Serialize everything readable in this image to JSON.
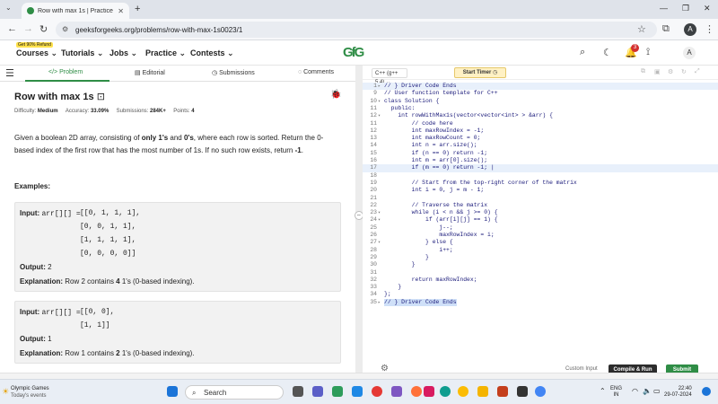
{
  "browser": {
    "tab_title": "Row with max 1s | Practice | Ge",
    "url": "geeksforgeeks.org/problems/row-with-max-1s0023/1",
    "profile_initial": "A"
  },
  "site_header": {
    "refund_badge": "Get 90% Refund",
    "nav": [
      "Courses",
      "Tutorials",
      "Jobs",
      "Practice",
      "Contests"
    ],
    "logo_text": "GfG",
    "notification_count": "3",
    "user_initial": "A"
  },
  "left_tabs": [
    "Problem",
    "Editorial",
    "Submissions",
    "Comments"
  ],
  "problem": {
    "title": "Row with max 1s",
    "difficulty_label": "Difficulty:",
    "difficulty": "Medium",
    "accuracy_label": "Accuracy:",
    "accuracy": "33.09%",
    "submissions_label": "Submissions:",
    "submissions": "284K+",
    "points_label": "Points:",
    "points": "4",
    "desc_1": "Given a boolean 2D array, consisting of ",
    "desc_b1": "only 1's",
    "desc_2": " and ",
    "desc_b2": "0's",
    "desc_3": ", where each row is sorted. Return the 0-based index of the first row that has the most number of 1s. If no such row exists, return ",
    "desc_b3": "-1",
    "desc_4": ".",
    "examples_heading": "Examples:"
  },
  "example1": {
    "input_label": "Input:",
    "input_var": "arr[][] =",
    "rows": [
      "[[0, 1, 1, 1],",
      "[0, 0, 1, 1],",
      "[1, 1, 1, 1],",
      "[0, 0, 0, 0]]"
    ],
    "output_label": "Output:",
    "output": "2",
    "expl_label": "Explanation:",
    "expl_1": "Row 2 contains ",
    "expl_b": "4",
    "expl_2": " 1's (0-based indexing)."
  },
  "example2": {
    "input_label": "Input:",
    "input_var": "arr[][] =",
    "rows": [
      "[[0, 0],",
      "[1, 1]]"
    ],
    "output_label": "Output:",
    "output": "1",
    "expl_label": "Explanation:",
    "expl_1": "Row 1 contains ",
    "expl_b": "2",
    "expl_2": " 1's (0-based indexing)."
  },
  "editor": {
    "language": "C++ (g++ 5.4)",
    "start_timer": "Start Timer",
    "custom_input": "Custom Input",
    "compile_run": "Compile & Run",
    "submit": "Submit",
    "lines": [
      {
        "n": "1",
        "fold": "▸",
        "text": "// } Driver Code Ends",
        "cls": "cmt",
        "hl": true
      },
      {
        "n": "9",
        "fold": "",
        "text": "// User function template for C++",
        "cls": "cmt"
      },
      {
        "n": "10",
        "fold": "▾",
        "text": "class Solution {",
        "cls": ""
      },
      {
        "n": "11",
        "fold": "",
        "text": "  public:",
        "cls": ""
      },
      {
        "n": "12",
        "fold": "▾",
        "text": "    int rowWithMax1s(vector<vector<int> > &arr) {",
        "cls": ""
      },
      {
        "n": "11",
        "fold": "",
        "text": "        // code here",
        "cls": "cmt"
      },
      {
        "n": "12",
        "fold": "",
        "text": "        int maxRowIndex = -1;",
        "cls": ""
      },
      {
        "n": "13",
        "fold": "",
        "text": "        int maxRowCount = 0;",
        "cls": ""
      },
      {
        "n": "14",
        "fold": "",
        "text": "        int n = arr.size();",
        "cls": ""
      },
      {
        "n": "15",
        "fold": "",
        "text": "        if (n == 0) return -1;",
        "cls": ""
      },
      {
        "n": "16",
        "fold": "",
        "text": "        int m = arr[0].size();",
        "cls": ""
      },
      {
        "n": "17",
        "fold": "",
        "text": "        if (m == 0) return -1; |",
        "cls": "",
        "hl": true
      },
      {
        "n": "18",
        "fold": "",
        "text": "",
        "cls": ""
      },
      {
        "n": "19",
        "fold": "",
        "text": "        // Start from the top-right corner of the matrix",
        "cls": "cmt"
      },
      {
        "n": "20",
        "fold": "",
        "text": "        int i = 0, j = m - 1;",
        "cls": ""
      },
      {
        "n": "21",
        "fold": "",
        "text": "",
        "cls": ""
      },
      {
        "n": "22",
        "fold": "",
        "text": "        // Traverse the matrix",
        "cls": "cmt"
      },
      {
        "n": "23",
        "fold": "▾",
        "text": "        while (i < n && j >= 0) {",
        "cls": ""
      },
      {
        "n": "24",
        "fold": "▾",
        "text": "            if (arr[i][j] == 1) {",
        "cls": ""
      },
      {
        "n": "25",
        "fold": "",
        "text": "                j--;",
        "cls": ""
      },
      {
        "n": "26",
        "fold": "",
        "text": "                maxRowIndex = i;",
        "cls": ""
      },
      {
        "n": "27",
        "fold": "▾",
        "text": "            } else {",
        "cls": ""
      },
      {
        "n": "28",
        "fold": "",
        "text": "                i++;",
        "cls": ""
      },
      {
        "n": "29",
        "fold": "",
        "text": "            }",
        "cls": ""
      },
      {
        "n": "30",
        "fold": "",
        "text": "        }",
        "cls": ""
      },
      {
        "n": "31",
        "fold": "",
        "text": "",
        "cls": ""
      },
      {
        "n": "32",
        "fold": "",
        "text": "        return maxRowIndex;",
        "cls": ""
      },
      {
        "n": "33",
        "fold": "",
        "text": "    }",
        "cls": ""
      },
      {
        "n": "34",
        "fold": "",
        "text": "};",
        "cls": ""
      },
      {
        "n": "35",
        "fold": "▸",
        "text": "// } Driver Code Ends",
        "cls": "cmt",
        "hl2": true
      }
    ]
  },
  "taskbar": {
    "weather_title": "Olympic Games",
    "weather_sub": "Today's events",
    "search": "Search",
    "lang": "ENG",
    "region": "IN",
    "time": "22:40",
    "date": "29-07-2024"
  },
  "colors": {
    "brand_green": "#2f8d46",
    "timer_bg": "#fff1c4"
  }
}
